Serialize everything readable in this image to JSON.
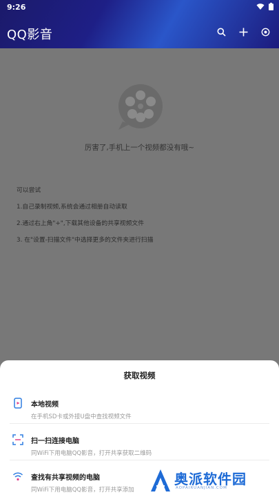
{
  "status_bar": {
    "time": "9:26"
  },
  "app_bar": {
    "title": "QQ影音"
  },
  "empty_state": {
    "message": "厉害了,手机上一个视频都没有哦~",
    "tips": [
      "可以尝试",
      "1.自己录制视频,系统会通过相册自动读取",
      "2.通过右上角\"+\",下载其他设备的共享视频文件",
      "3. 在\"设置-扫描文件\"中选择更多的文件夹进行扫描"
    ]
  },
  "sheet": {
    "title": "获取视频",
    "options": [
      {
        "title": "本地视频",
        "desc": "在手机SD卡或外接U盘中查找视频文件"
      },
      {
        "title": "扫一扫连接电脑",
        "desc": "同WiFi下用电脑QQ影音，打开共享获取二维码"
      },
      {
        "title": "查找有共享视频的电脑",
        "desc": "同WiFi下用电脑QQ影音，打开共享添加"
      }
    ]
  },
  "watermark": {
    "text": "奥派软件园",
    "sub": "AOPAIRUANJIAN.COM"
  },
  "colors": {
    "app_bar": "#1e1f86",
    "accent": "#2f7de1",
    "overlay": "#787878"
  }
}
